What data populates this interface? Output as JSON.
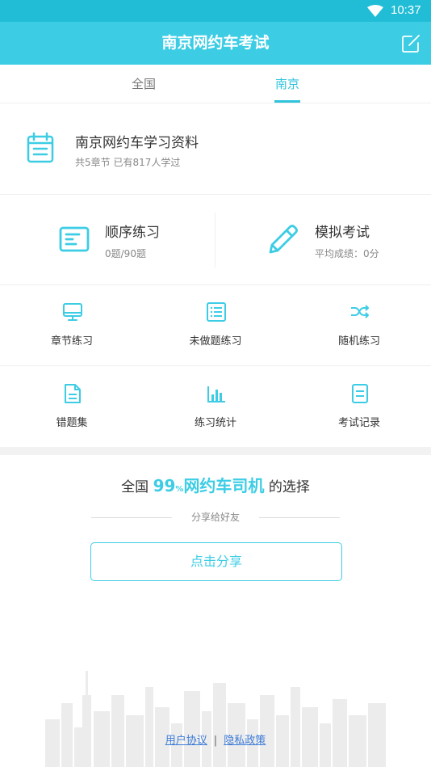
{
  "status_bar": {
    "time": "10:37",
    "wifi_icon": "wifi-icon"
  },
  "header": {
    "title": "南京网约车考试",
    "share_icon": "edit-share-icon",
    "background": "#3ccde5"
  },
  "tabs": [
    {
      "label": "全国",
      "selected": false
    },
    {
      "label": "南京",
      "selected": true
    }
  ],
  "study_material": {
    "icon": "calendar-list-icon",
    "title": "南京网约车学习资料",
    "subtitle": "共5章节  已有817人学过"
  },
  "main_actions": [
    {
      "icon": "list-card-icon",
      "label": "顺序练习",
      "sub": "0题/90题"
    },
    {
      "icon": "pencil-icon",
      "label": "模拟考试",
      "sub": "平均成绩：0分"
    }
  ],
  "grid": [
    {
      "icon": "monitor-icon",
      "label": "章节练习"
    },
    {
      "icon": "list-icon",
      "label": "未做题练习"
    },
    {
      "icon": "shuffle-icon",
      "label": "随机练习"
    },
    {
      "icon": "document-icon",
      "label": "错题集"
    },
    {
      "icon": "bar-chart-icon",
      "label": "练习统计"
    },
    {
      "icon": "record-icon",
      "label": "考试记录"
    }
  ],
  "promo": {
    "prefix": "全国",
    "highlight_num": "99",
    "highlight_pct": "%",
    "highlight_text": "网约车司机",
    "suffix": "的选择",
    "share_hint": "分享给好友",
    "share_button": "点击分享"
  },
  "footer": {
    "user_agreement": "用户协议",
    "separator": "|",
    "privacy_policy": "隐私政策"
  },
  "colors": {
    "accent": "#3ccde5",
    "status_bar": "#21bdd6",
    "link": "#3d7bd6"
  }
}
